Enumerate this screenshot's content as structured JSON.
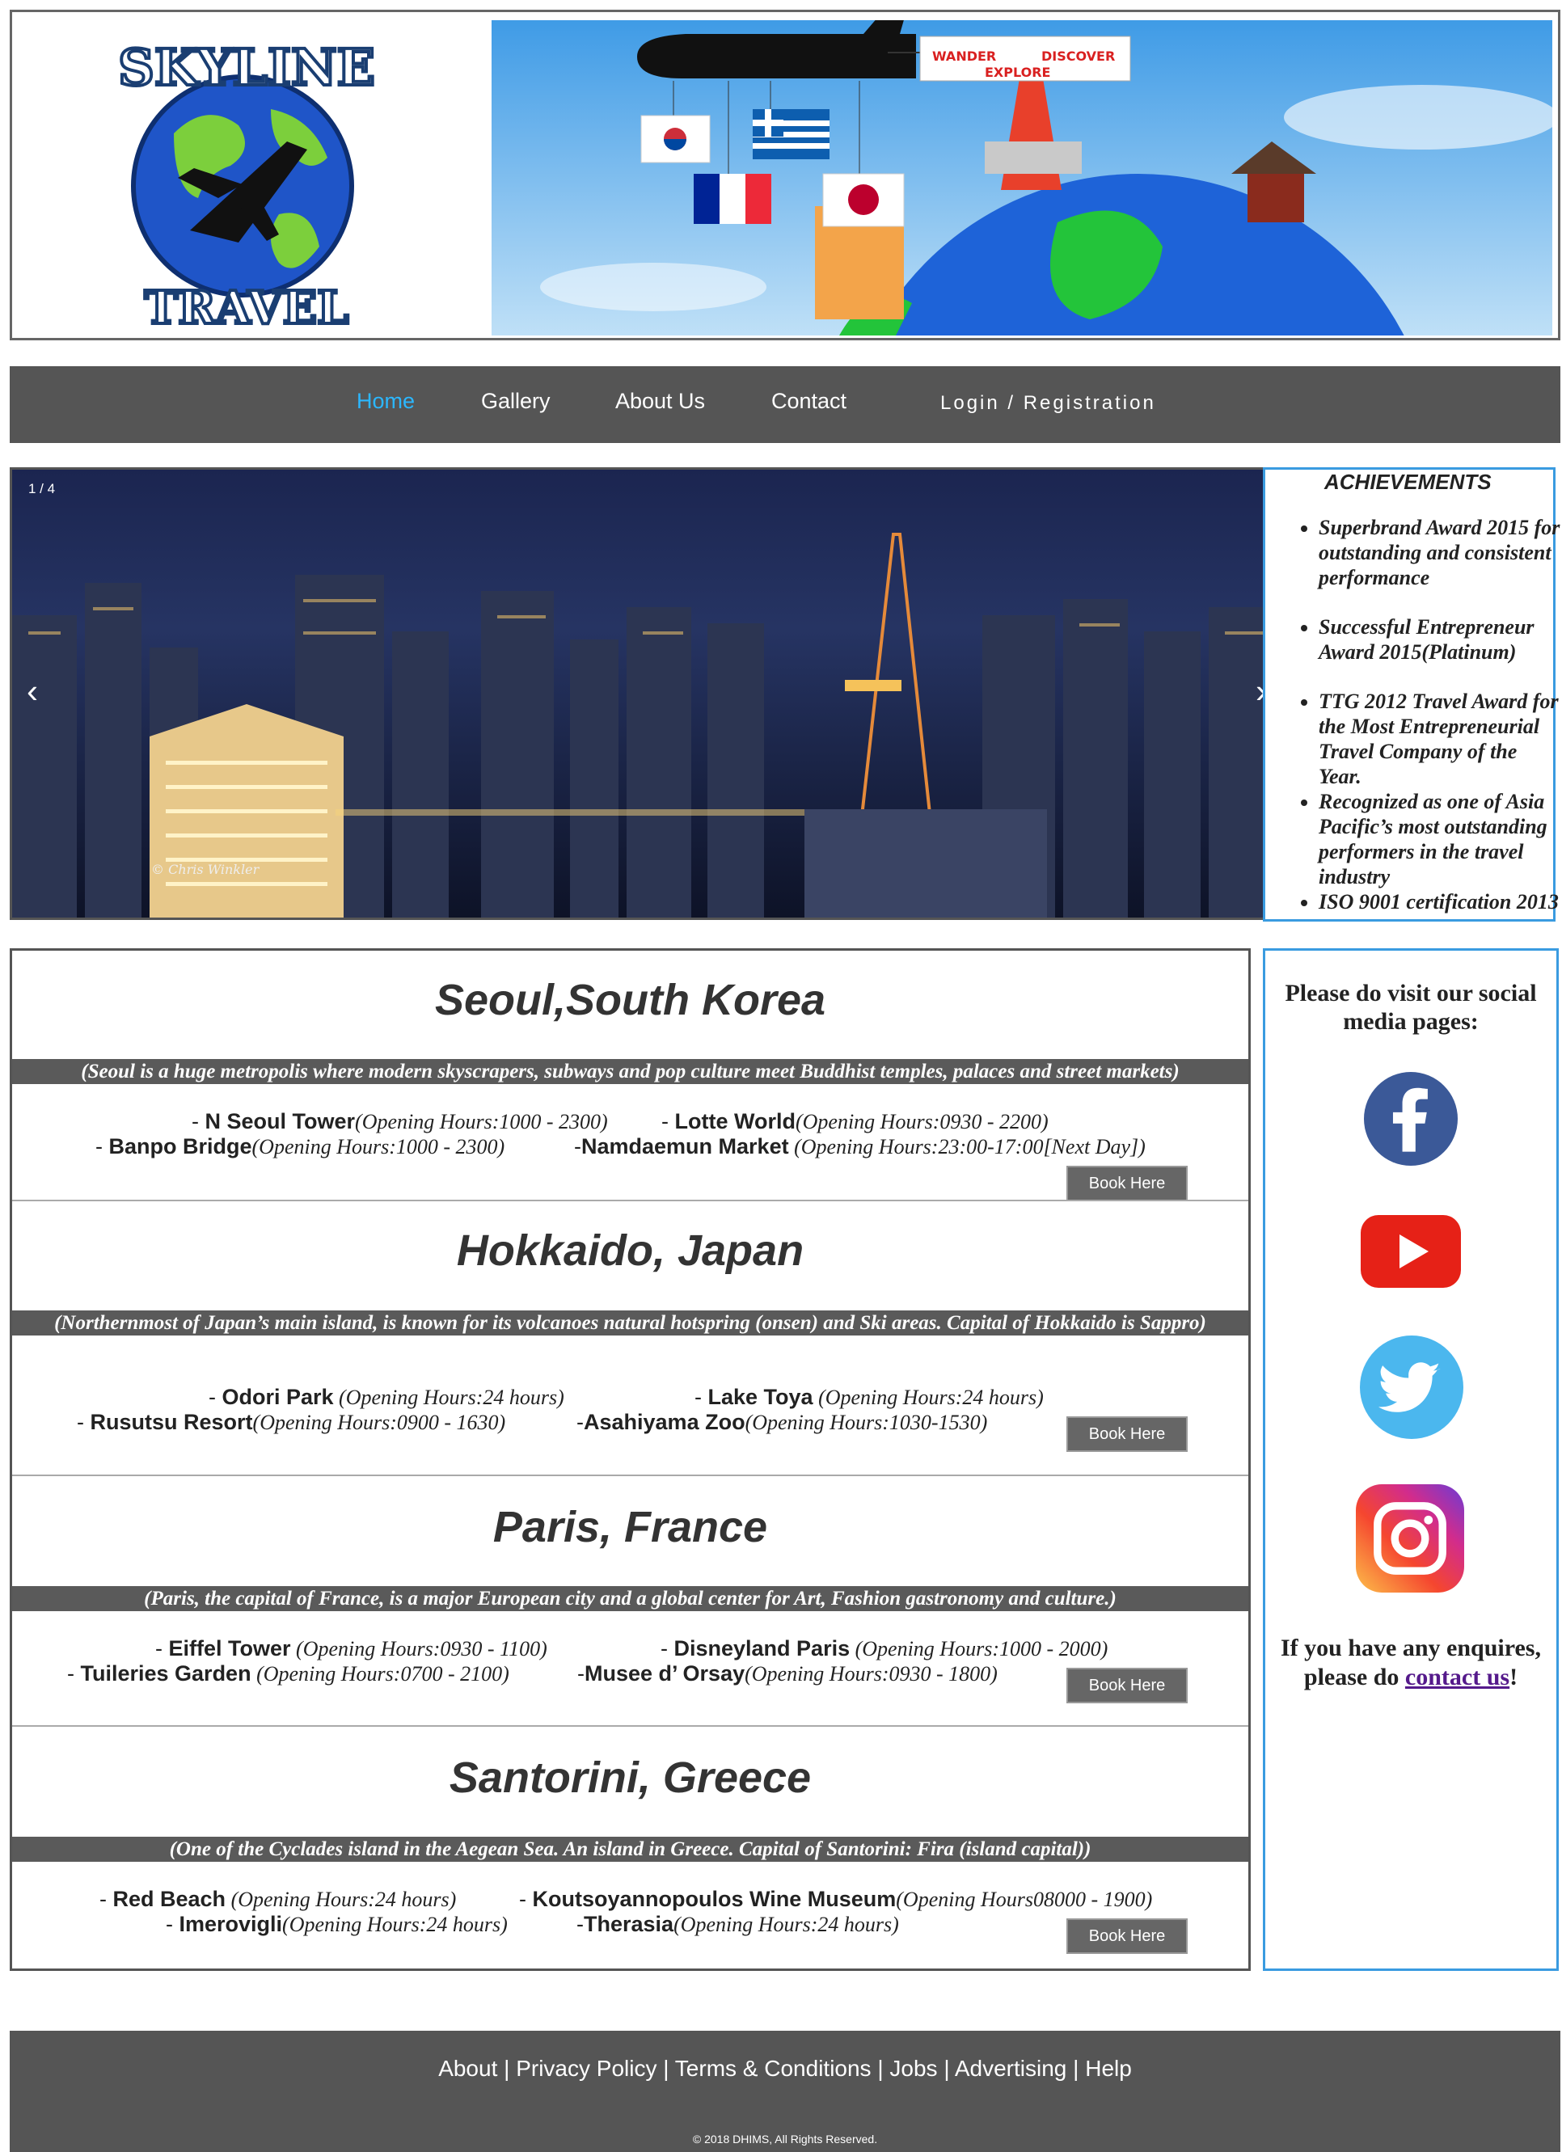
{
  "header": {
    "logo_text_top": "SKYLINE",
    "logo_text_bottom": "TRAVEL",
    "banner_tags": [
      "WANDER",
      "DISCOVER",
      "EXPLORE"
    ]
  },
  "nav": {
    "home": "Home",
    "gallery": "Gallery",
    "about": "About Us",
    "contact": "Contact",
    "login": "Login / Registration",
    "active_color": "#2bb7ff"
  },
  "slider": {
    "counter": "1 / 4",
    "prev": "‹",
    "next": "›",
    "photo_credit": "© Chris Winkler"
  },
  "achievements": {
    "title": "ACHIEVEMENTS",
    "items": [
      "Superbrand Award 2015 for outstanding and consistent performance",
      "Successful Entrepreneur Award 2015(Platinum)",
      "TTG 2012 Travel Award for the Most Entrepreneurial Travel Company of the Year.",
      "Recognized as one of Asia Pacific’s most outstanding performers in the travel industry",
      "ISO 9001 certification 2013"
    ]
  },
  "destinations": [
    {
      "title": "Seoul,South Korea",
      "desc": "(Seoul is a huge metropolis where modern skyscrapers, subways and pop culture meet Buddhist temples, palaces and street markets)",
      "attractions": [
        {
          "prefix": "-  ",
          "name": "N Seoul Tower",
          "hours": "(Opening Hours:1000 - 2300)"
        },
        {
          "prefix": "-  ",
          "name": "Lotte World",
          "hours": "(Opening Hours:0930 - 2200)"
        },
        {
          "prefix": "-  ",
          "name": "Banpo Bridge",
          "hours": "(Opening Hours:1000 - 2300)"
        },
        {
          "prefix": "-",
          "name": "Namdaemun Market",
          "hours": " (Opening Hours:23:00-17:00[Next Day])"
        }
      ],
      "book": "Book Here"
    },
    {
      "title": "Hokkaido, Japan",
      "desc": "(Northernmost of Japan’s main island, is known for its volcanoes natural hotspring (onsen) and Ski areas. Capital of Hokkaido is Sappro)",
      "attractions": [
        {
          "prefix": "-  ",
          "name": "Odori Park",
          "hours": " (Opening Hours:24 hours)"
        },
        {
          "prefix": "-  ",
          "name": "Lake Toya",
          "hours": " (Opening Hours:24 hours)"
        },
        {
          "prefix": "-  ",
          "name": "Rusutsu Resort",
          "hours": "(Opening Hours:0900 - 1630)"
        },
        {
          "prefix": "-",
          "name": "Asahiyama Zoo",
          "hours": "(Opening Hours:1030-1530)"
        }
      ],
      "book": "Book Here"
    },
    {
      "title": "Paris, France",
      "desc": "(Paris, the capital of France, is a major European city and a global center for Art, Fashion gastronomy and culture.)",
      "attractions": [
        {
          "prefix": "-  ",
          "name": "Eiffel Tower",
          "hours": " (Opening Hours:0930 - 1100)"
        },
        {
          "prefix": "- ",
          "name": "Disneyland Paris",
          "hours": " (Opening Hours:1000 - 2000)"
        },
        {
          "prefix": "-  ",
          "name": "Tuileries Garden",
          "hours": " (Opening Hours:0700 - 2100)"
        },
        {
          "prefix": "-",
          "name": "Musee d’ Orsay",
          "hours": "(Opening Hours:0930 - 1800)"
        }
      ],
      "book": "Book Here"
    },
    {
      "title": "Santorini, Greece",
      "desc": "(One of the Cyclades island in the Aegean Sea. An island in Greece. Capital of Santorini: Fira (island capital))",
      "attractions": [
        {
          "prefix": "-  ",
          "name": "Red Beach",
          "hours": " (Opening Hours:24 hours)"
        },
        {
          "prefix": "- ",
          "name": "Koutsoyannopoulos Wine Museum",
          "hours": "(Opening Hours08000 - 1900)"
        },
        {
          "prefix": "-  ",
          "name": "Imerovigli",
          "hours": "(Opening Hours:24 hours)"
        },
        {
          "prefix": "-",
          "name": "Therasia",
          "hours": "(Opening Hours:24 hours)"
        }
      ],
      "book": "Book Here"
    }
  ],
  "social": {
    "title": "Please do visit our social media pages:",
    "enquire_before": "If you have any enquires, please do ",
    "enquire_link": "contact us",
    "enquire_after": "!",
    "icons": [
      "facebook-icon",
      "youtube-icon",
      "twitter-icon",
      "instagram-icon"
    ]
  },
  "footer": {
    "links": [
      "About",
      "Privacy Policy",
      "Terms & Conditions",
      "Jobs",
      "Advertising",
      "Help"
    ],
    "separator": " | ",
    "copyright": "© 2018 DHIMS, All Rights Reserved."
  }
}
